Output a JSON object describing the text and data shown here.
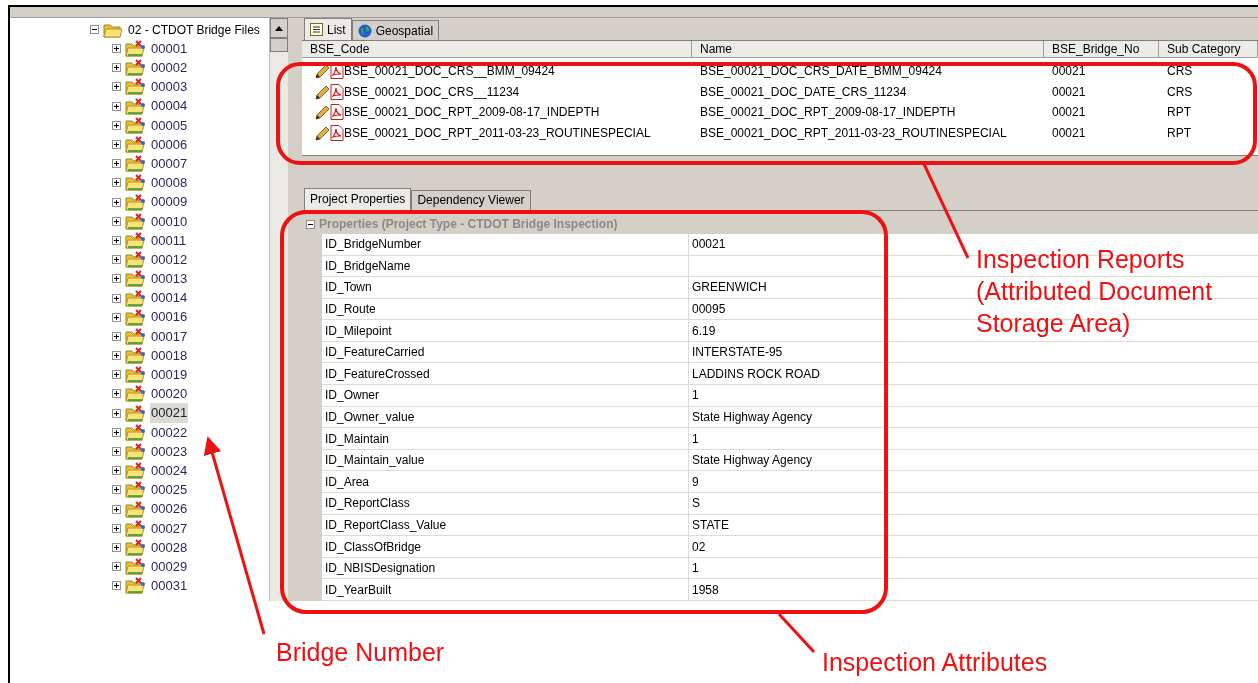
{
  "tree": {
    "label": "02 - CTDOT Bridge Files",
    "expanded": true,
    "children": [
      {
        "label": "00001",
        "selected": false,
        "expanded": false
      },
      {
        "label": "00002",
        "selected": false,
        "expanded": false
      },
      {
        "label": "00003",
        "selected": false,
        "expanded": false
      },
      {
        "label": "00004",
        "selected": false,
        "expanded": false
      },
      {
        "label": "00005",
        "selected": false,
        "expanded": false
      },
      {
        "label": "00006",
        "selected": false,
        "expanded": false
      },
      {
        "label": "00007",
        "selected": false,
        "expanded": false
      },
      {
        "label": "00008",
        "selected": false,
        "expanded": false
      },
      {
        "label": "00009",
        "selected": false,
        "expanded": false
      },
      {
        "label": "00010",
        "selected": false,
        "expanded": false
      },
      {
        "label": "00011",
        "selected": false,
        "expanded": false
      },
      {
        "label": "00012",
        "selected": false,
        "expanded": false
      },
      {
        "label": "00013",
        "selected": false,
        "expanded": false
      },
      {
        "label": "00014",
        "selected": false,
        "expanded": false
      },
      {
        "label": "00016",
        "selected": false,
        "expanded": false
      },
      {
        "label": "00017",
        "selected": false,
        "expanded": false
      },
      {
        "label": "00018",
        "selected": false,
        "expanded": false
      },
      {
        "label": "00019",
        "selected": false,
        "expanded": false
      },
      {
        "label": "00020",
        "selected": false,
        "expanded": false
      },
      {
        "label": "00021",
        "selected": true,
        "expanded": false
      },
      {
        "label": "00022",
        "selected": false,
        "expanded": false
      },
      {
        "label": "00023",
        "selected": false,
        "expanded": false
      },
      {
        "label": "00024",
        "selected": false,
        "expanded": false
      },
      {
        "label": "00025",
        "selected": false,
        "expanded": false
      },
      {
        "label": "00026",
        "selected": false,
        "expanded": false
      },
      {
        "label": "00027",
        "selected": false,
        "expanded": false
      },
      {
        "label": "00028",
        "selected": false,
        "expanded": false
      },
      {
        "label": "00029",
        "selected": false,
        "expanded": false
      },
      {
        "label": "00031",
        "selected": false,
        "expanded": false
      }
    ]
  },
  "view_tabs": [
    {
      "label": "List",
      "kind": "list",
      "selected": true
    },
    {
      "label": "Geospatial",
      "kind": "globe",
      "selected": false
    }
  ],
  "documents": {
    "columns": [
      "BSE_Code",
      "Name",
      "BSE_Bridge_No",
      "Sub Category"
    ],
    "rows": [
      [
        "BSE_00021_DOC_CRS__BMM_09424",
        "BSE_00021_DOC_CRS_DATE_BMM_09424",
        "00021",
        "CRS"
      ],
      [
        "BSE_00021_DOC_CRS__11234",
        "BSE_00021_DOC_DATE_CRS_11234",
        "00021",
        "CRS"
      ],
      [
        "BSE_00021_DOC_RPT_2009-08-17_INDEPTH",
        "BSE_00021_DOC_RPT_2009-08-17_INDEPTH",
        "00021",
        "RPT"
      ],
      [
        "BSE_00021_DOC_RPT_2011-03-23_ROUTINESPECIAL",
        "BSE_00021_DOC_RPT_2011-03-23_ROUTINESPECIAL",
        "00021",
        "RPT"
      ]
    ]
  },
  "detail_tabs": [
    {
      "label": "Project Properties",
      "selected": true
    },
    {
      "label": "Dependency Viewer",
      "selected": false
    }
  ],
  "properties": {
    "group": "Properties (Project Type - CTDOT Bridge Inspection)",
    "expanded": true,
    "rows": [
      {
        "name": "ID_BridgeNumber",
        "value": "00021"
      },
      {
        "name": "ID_BridgeName"
      },
      {
        "name": "ID_Town",
        "value": "GREENWICH"
      },
      {
        "name": "ID_Route",
        "value": "00095"
      },
      {
        "name": "ID_Milepoint",
        "value": "6.19"
      },
      {
        "name": "ID_FeatureCarried",
        "value": "INTERSTATE-95"
      },
      {
        "name": "ID_FeatureCrossed",
        "value": "LADDINS ROCK ROAD"
      },
      {
        "name": "ID_Owner",
        "value": "1"
      },
      {
        "name": "ID_Owner_value",
        "value": "State Highway Agency"
      },
      {
        "name": "ID_Maintain",
        "value": "1"
      },
      {
        "name": "ID_Maintain_value",
        "value": "State Highway Agency"
      },
      {
        "name": "ID_Area",
        "value": "9"
      },
      {
        "name": "ID_ReportClass",
        "value": "S"
      },
      {
        "name": "ID_ReportClass_Value",
        "value": "STATE"
      },
      {
        "name": "ID_ClassOfBridge",
        "value": "02"
      },
      {
        "name": "ID_NBISDesignation",
        "value": "1"
      },
      {
        "name": "ID_YearBuilt",
        "value": "1958"
      }
    ]
  },
  "callouts": [
    {
      "text": "Inspection Reports (Attributed Document Storage Area)"
    },
    {
      "text": "Bridge Number"
    },
    {
      "text": "Inspection Attributes"
    }
  ]
}
